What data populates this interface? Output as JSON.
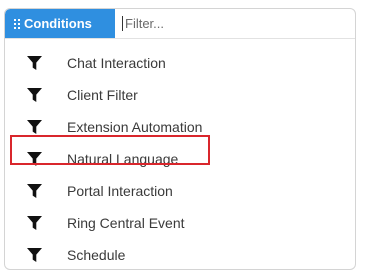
{
  "header": {
    "conditions_label": "Conditions",
    "filter_placeholder": "Filter...",
    "filter_value": ""
  },
  "items": [
    {
      "label": "Chat Interaction",
      "icon": "funnel-icon"
    },
    {
      "label": "Client Filter",
      "icon": "funnel-icon"
    },
    {
      "label": "Extension Automation",
      "icon": "funnel-icon"
    },
    {
      "label": "Natural Language",
      "icon": "funnel-icon",
      "highlighted": true
    },
    {
      "label": "Portal Interaction",
      "icon": "funnel-icon"
    },
    {
      "label": "Ring Central Event",
      "icon": "funnel-icon"
    },
    {
      "label": "Schedule",
      "icon": "funnel-icon"
    }
  ],
  "colors": {
    "accent": "#2f8fe0",
    "highlight": "#d9262c",
    "text": "#3a3a3a"
  }
}
